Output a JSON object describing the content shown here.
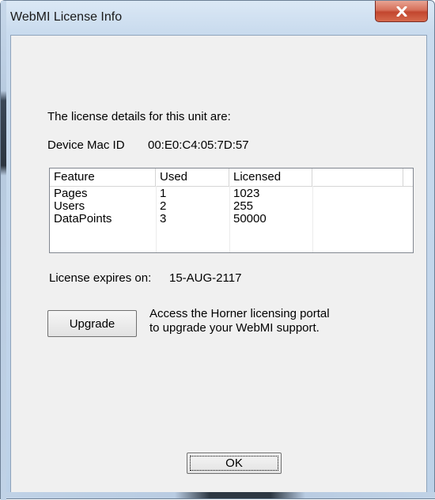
{
  "window": {
    "title": "WebMI License Info"
  },
  "content": {
    "intro": "The license details for this unit are:",
    "device_label": "Device Mac ID",
    "device_value": "00:E0:C4:05:7D:57",
    "expires_label": "License expires on:",
    "expires_value": "15-AUG-2117",
    "portal_text_line1": "Access the Horner licensing portal",
    "portal_text_line2": "to upgrade your WebMI support."
  },
  "table": {
    "headers": [
      "Feature",
      "Used",
      "Licensed",
      ""
    ],
    "rows": [
      [
        "Pages",
        "1",
        "1023"
      ],
      [
        "Users",
        "2",
        "255"
      ],
      [
        "DataPoints",
        "3",
        "50000"
      ]
    ]
  },
  "buttons": {
    "upgrade_label": "Upgrade",
    "ok_label": "OK"
  },
  "icons": {
    "close": "close-icon"
  }
}
